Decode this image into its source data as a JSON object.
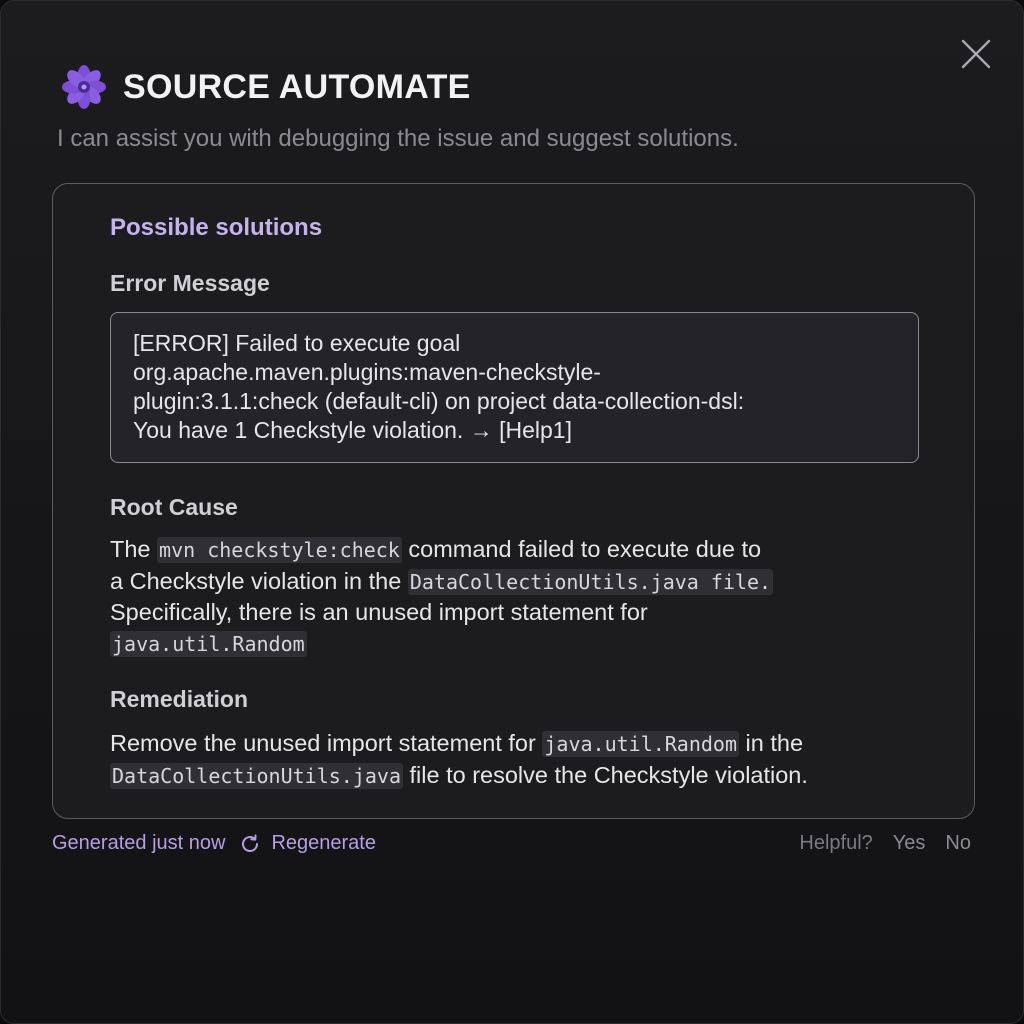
{
  "app": {
    "title": "SOURCE AUTOMATE",
    "subtitle": "I can assist you with debugging the issue and suggest solutions.",
    "logo_icon": "violet-flower-icon",
    "accent_color": "#b89de6"
  },
  "card": {
    "title": "Possible solutions",
    "error_message": {
      "heading": "Error Message",
      "text": "[ERROR] Failed to execute goal\norg.apache.maven.plugins:maven-checkstyle-\nplugin:3.1.1:check (default-cli) on project data-collection-dsl:\nYou have 1 Checkstyle violation. → [Help1]"
    },
    "root_cause": {
      "heading": "Root Cause",
      "t1": "The ",
      "c1": "mvn checkstyle:check",
      "t2": " command failed to execute due to",
      "t3": "a Checkstyle violation in the ",
      "c2": "DataCollectionUtils.java file.",
      "t4": "Specifically, there is an unused import statement for",
      "c3": "java.util.Random"
    },
    "remediation": {
      "heading": "Remediation",
      "t1": "Remove the unused import statement for ",
      "c1": "java.util.Random",
      "t2": " in the",
      "c2": "DataCollectionUtils.java",
      "t3": " file to resolve the Checkstyle violation."
    }
  },
  "footer": {
    "generated": "Generated just now",
    "regenerate": "Regenerate",
    "helpful": "Helpful?",
    "yes": "Yes",
    "no": "No"
  }
}
